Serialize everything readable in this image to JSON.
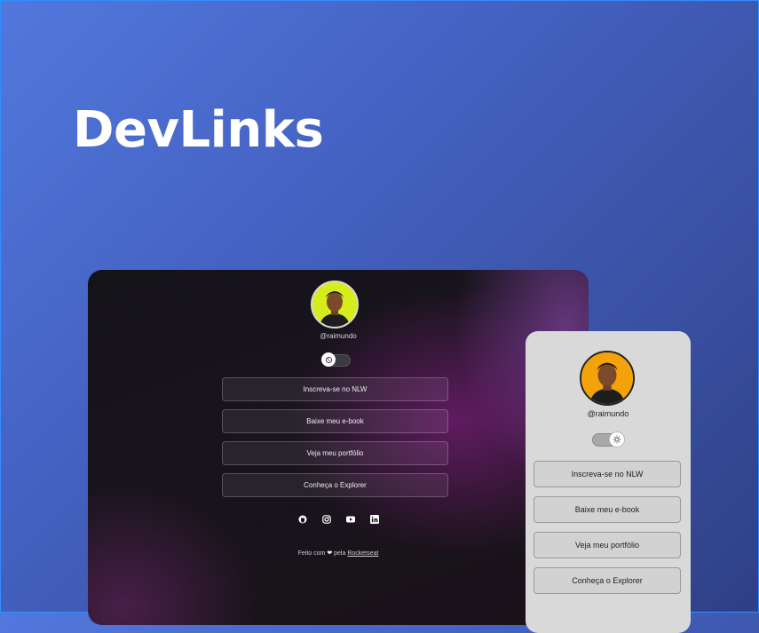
{
  "hero": {
    "title": "DevLinks"
  },
  "dark_preview": {
    "handle": "@raimundo",
    "theme_toggle": "dark",
    "links": [
      {
        "label": "Inscreva-se no NLW"
      },
      {
        "label": "Baixe meu e-book"
      },
      {
        "label": "Veja meu portfólio"
      },
      {
        "label": "Conheça o Explorer"
      }
    ],
    "social_icons": [
      "github-icon",
      "instagram-icon",
      "youtube-icon",
      "linkedin-icon"
    ],
    "footer": {
      "prefix": "Feito com",
      "heart": "❤",
      "middle": "pela",
      "brand": "Rocketseat"
    }
  },
  "light_preview": {
    "handle": "@raimundo",
    "theme_toggle": "light",
    "links": [
      {
        "label": "Inscreva-se no NLW"
      },
      {
        "label": "Baixe meu e-book"
      },
      {
        "label": "Veja meu portfólio"
      },
      {
        "label": "Conheça o Explorer"
      }
    ]
  },
  "colors": {
    "background_start": "#5278dd",
    "background_end": "#2e3f86",
    "dark_avatar_bg": "#d6ec1c",
    "light_avatar_bg": "#f4a20a",
    "light_card_bg": "#d9d9d9"
  }
}
